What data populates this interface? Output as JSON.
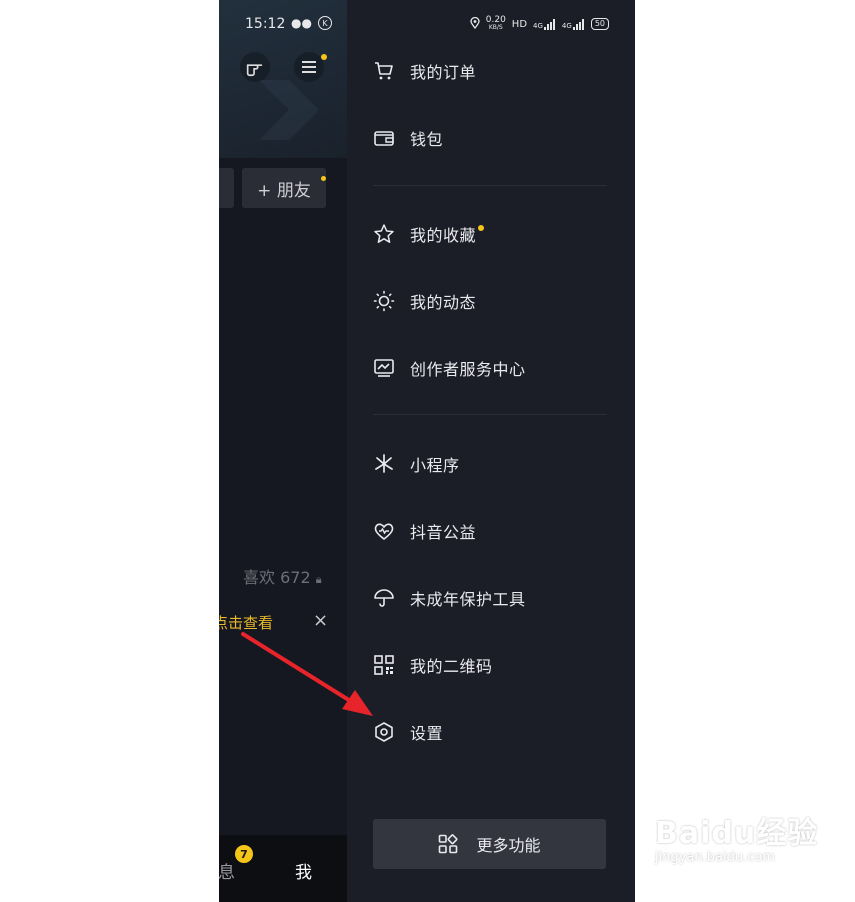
{
  "status_bar": {
    "time": "15:12",
    "speed_value": "0.20",
    "speed_unit": "KB/S",
    "hd": "HD",
    "net1": "4G",
    "net2": "4G",
    "battery": "50"
  },
  "background_page": {
    "add_friend_label": "+ 朋友",
    "likes_label": "喜欢 672",
    "view_link": "点击查看",
    "close_symbol": "×",
    "tabs": {
      "messages": "消息",
      "messages_badge": "7",
      "me": "我"
    }
  },
  "drawer": {
    "items": [
      {
        "label": "我的订单",
        "icon": "cart-icon"
      },
      {
        "label": "钱包",
        "icon": "wallet-icon"
      },
      {
        "label": "我的收藏",
        "icon": "star-icon",
        "has_dot": true
      },
      {
        "label": "我的动态",
        "icon": "sun-icon"
      },
      {
        "label": "创作者服务中心",
        "icon": "chart-icon"
      },
      {
        "label": "小程序",
        "icon": "mini-program-icon"
      },
      {
        "label": "抖音公益",
        "icon": "heart-icon"
      },
      {
        "label": "未成年保护工具",
        "icon": "umbrella-icon"
      },
      {
        "label": "我的二维码",
        "icon": "qr-code-icon"
      },
      {
        "label": "设置",
        "icon": "settings-icon"
      }
    ],
    "more_button": "更多功能"
  },
  "watermark": {
    "main": "Baidu经验",
    "sub": "jingyan.baidu.com"
  },
  "colors": {
    "drawer_bg": "#1c1e27",
    "accent_yellow": "#f5c518",
    "arrow_red": "#e8242b"
  }
}
